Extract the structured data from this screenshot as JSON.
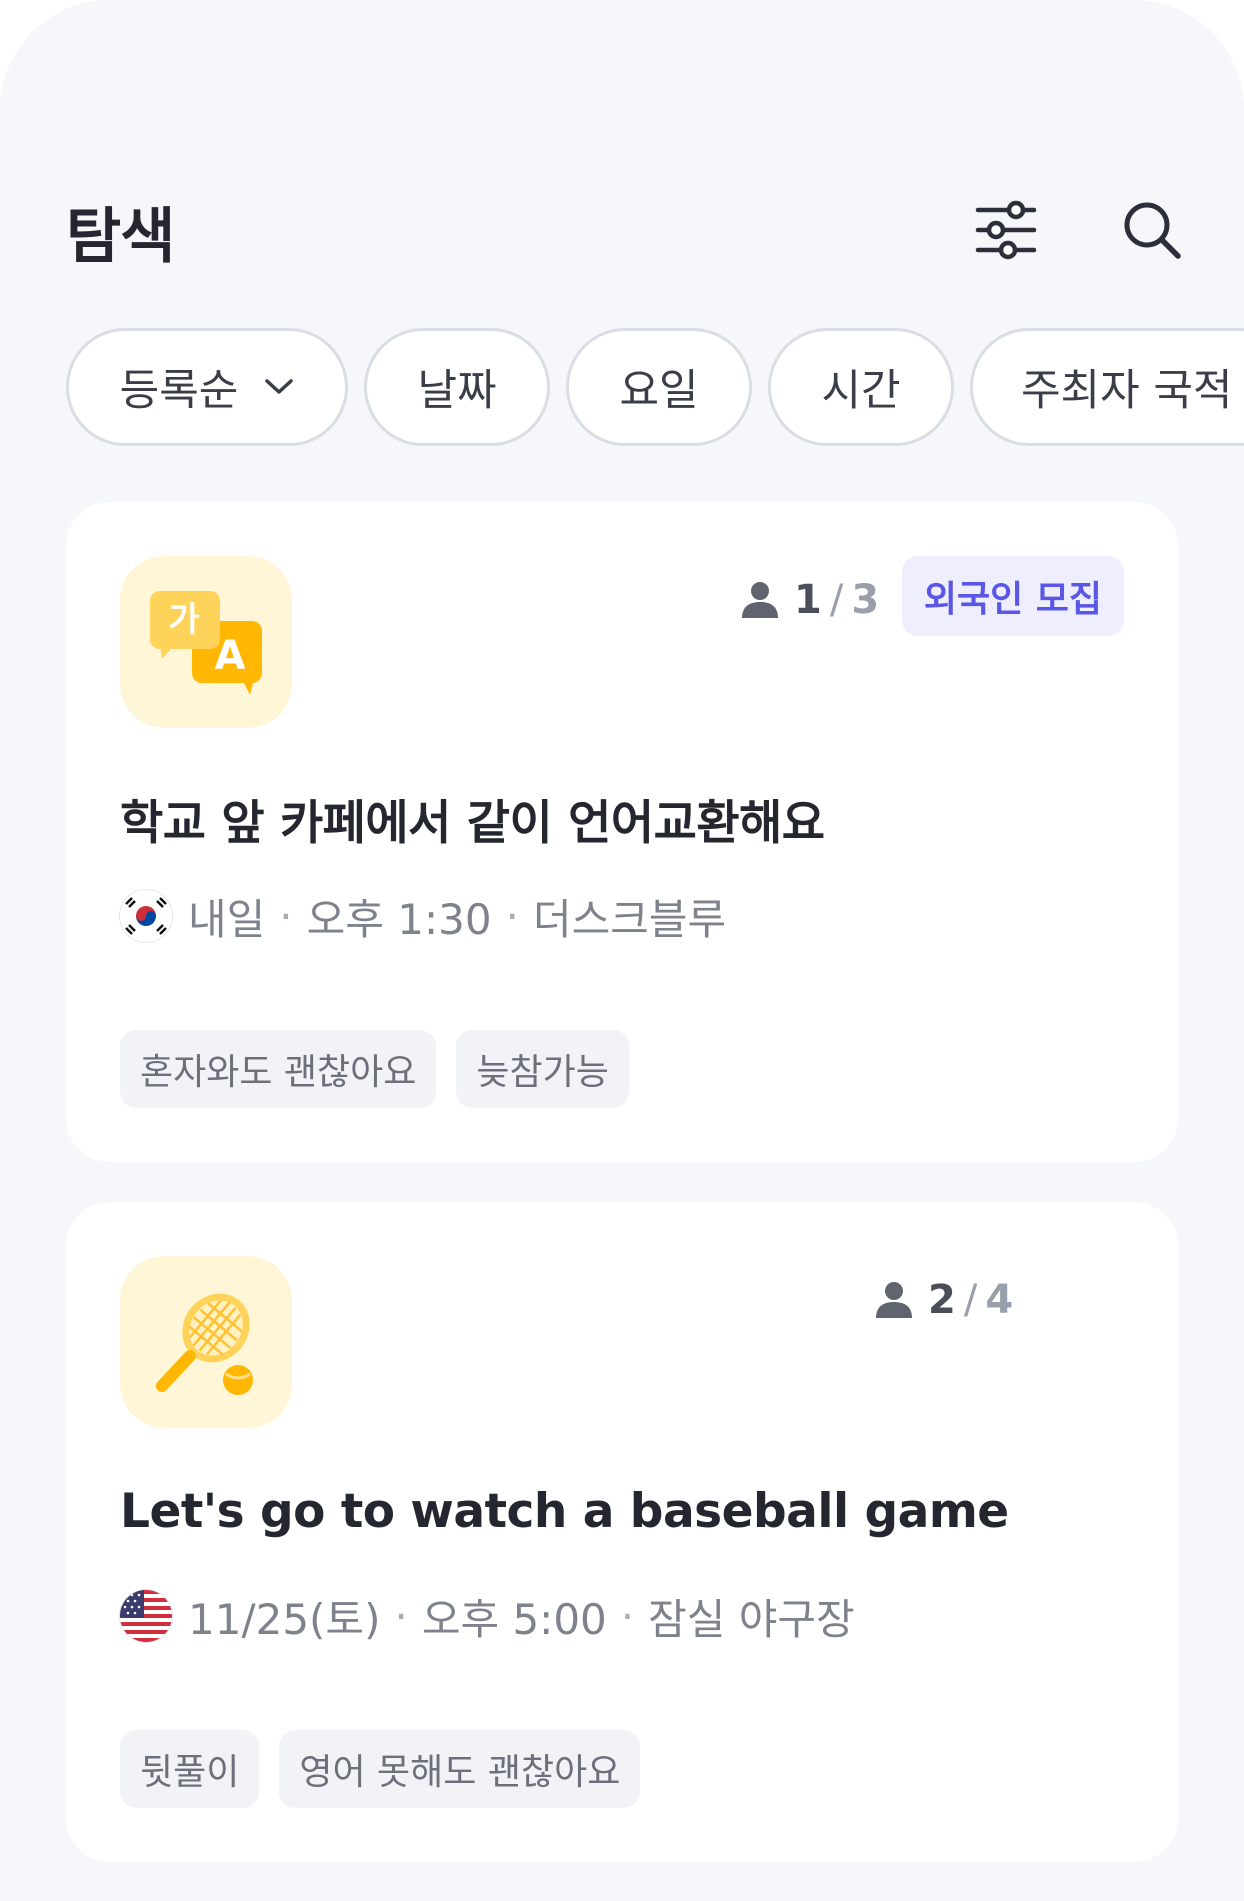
{
  "header": {
    "title": "탐색",
    "filter_icon": "sliders-icon",
    "search_icon": "search-icon"
  },
  "chips": [
    {
      "label": "등록순",
      "has_dropdown": true
    },
    {
      "label": "날짜"
    },
    {
      "label": "요일"
    },
    {
      "label": "시간"
    },
    {
      "label": "주최자 국적"
    }
  ],
  "cards": [
    {
      "icon": "language-exchange-icon",
      "members_current": "1",
      "members_sep": "/",
      "members_max": "3",
      "badge": "외국인 모집",
      "title": "학교 앞 카페에서 같이 언어교환해요",
      "flag": "korea-flag-icon",
      "date": "내일",
      "time": "오후 1:30",
      "place": "더스크블루",
      "tags": [
        "혼자와도 괜찮아요",
        "늦참가능"
      ]
    },
    {
      "icon": "tennis-icon",
      "members_current": "2",
      "members_sep": "/",
      "members_max": "4",
      "title": "Let's go to watch a baseball game",
      "flag": "usa-flag-icon",
      "date": "11/25(토)",
      "time": "오후 5:00",
      "place": "잠실 야구장",
      "tags": [
        "뒷풀이",
        "영어 못해도 괜찮아요"
      ]
    }
  ],
  "colors": {
    "background": "#f6f7fa",
    "badge_bg": "#eeeefe",
    "badge_text": "#5b57e6",
    "thumb_bg": "#fff6d8",
    "accent_yellow": "#ffb703"
  }
}
